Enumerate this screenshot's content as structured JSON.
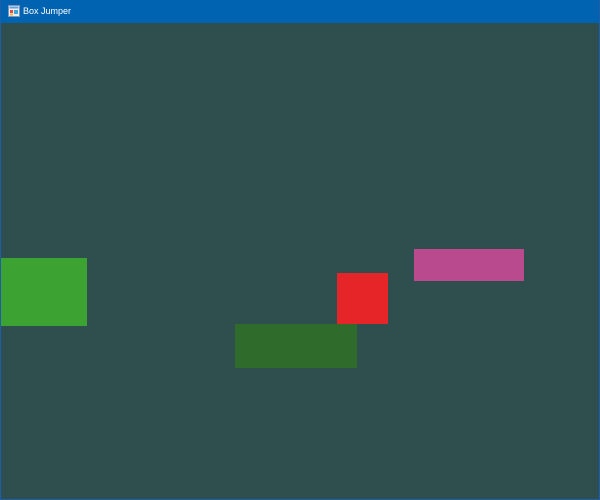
{
  "window": {
    "title": "Box Jumper",
    "icon": "app-window-icon"
  },
  "colors": {
    "background": "#2f4f4f",
    "titlebar": "#0063b1",
    "left_platform": "#3ca332",
    "dark_platform": "#2f6b2a",
    "player": "#e52527",
    "pink_platform": "#b84a8d"
  }
}
